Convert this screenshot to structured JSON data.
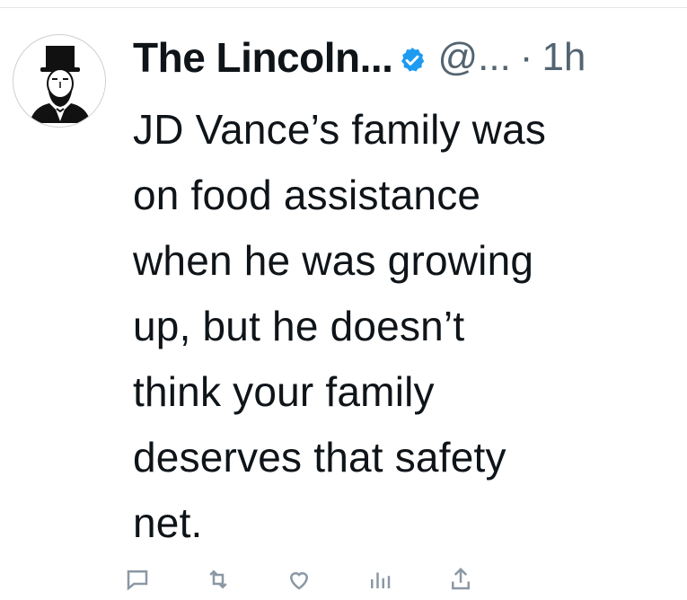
{
  "tweet": {
    "display_name": "The Lincoln...",
    "handle": "@...",
    "separator": "·",
    "time": "1h",
    "text": "JD Vance’s family was\non food assistance\nwhen he was growing\nup, but he doesn’t\nthink your family\ndeserves that safety\nnet.",
    "verified_color": "#1d9bf0",
    "avatar_icon": "abraham-lincoln-portrait"
  },
  "actions": {
    "icons": [
      "comment-icon",
      "retweet-icon",
      "like-icon",
      "views-icon",
      "share-icon"
    ]
  }
}
